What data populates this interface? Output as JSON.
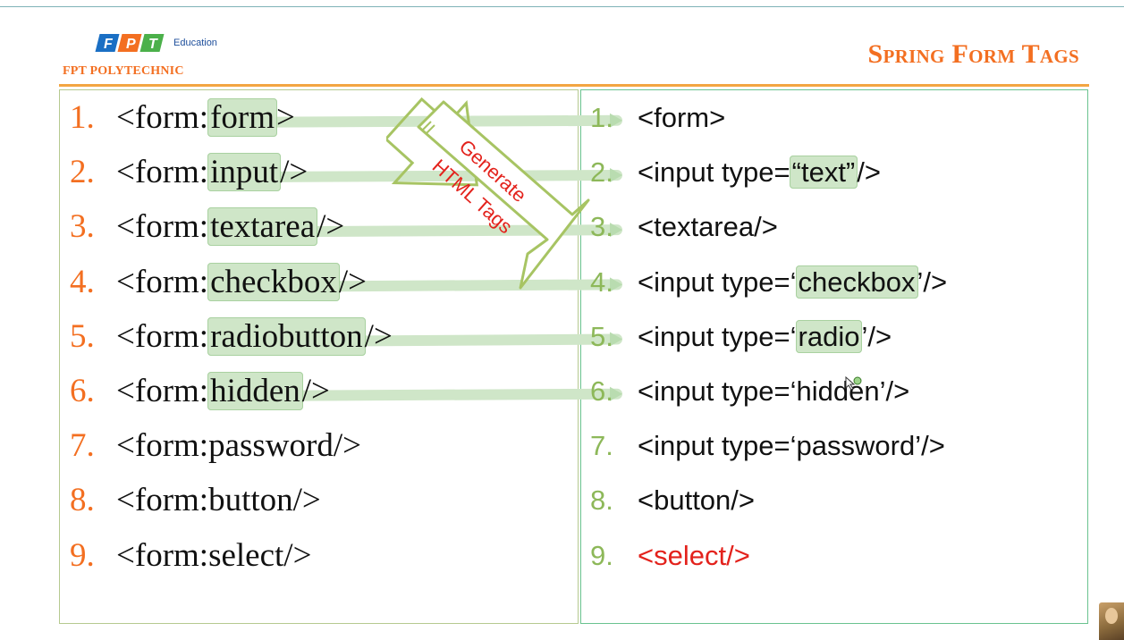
{
  "header": {
    "logo_edu": "Education",
    "logo_text": "FPT POLYTECHNIC",
    "title": "Spring Form Tags"
  },
  "colors": {
    "accent": "#f36f21",
    "highlight": "#cfe6c8",
    "green_number": "#8db859",
    "red": "#e3221c"
  },
  "callout": {
    "line1": "Generate",
    "line2": "HTML Tags"
  },
  "left_items": [
    {
      "num": "1.",
      "pre": "<form:",
      "hl": "form",
      "post": ">"
    },
    {
      "num": "2.",
      "pre": "<form:",
      "hl": "input",
      "post": "/>"
    },
    {
      "num": "3.",
      "pre": "<form:",
      "hl": "textarea",
      "post": "/>"
    },
    {
      "num": "4.",
      "pre": "<form:",
      "hl": "checkbox",
      "post": "/>"
    },
    {
      "num": "5.",
      "pre": "<form:",
      "hl": "radiobutton",
      "post": "/>"
    },
    {
      "num": "6.",
      "pre": "<form:",
      "hl": "hidden",
      "post": "/>"
    },
    {
      "num": "7.",
      "pre": "<form:password/>",
      "hl": "",
      "post": ""
    },
    {
      "num": "8.",
      "pre": "<form:button/>",
      "hl": "",
      "post": ""
    },
    {
      "num": "9.",
      "pre": "<form:select/>",
      "hl": "",
      "post": ""
    }
  ],
  "right_items": [
    {
      "num": "1.",
      "pre": "<form>",
      "hl": "",
      "post": ""
    },
    {
      "num": "2.",
      "pre": "<input type=",
      "hl": "“text”",
      "post": "/>"
    },
    {
      "num": "3.",
      "pre": "<textarea/>",
      "hl": "",
      "post": ""
    },
    {
      "num": "4.",
      "pre": "<input type=‘",
      "hl": "checkbox",
      "post": "’/>"
    },
    {
      "num": "5.",
      "pre": "<input type=‘",
      "hl": "radio",
      "post": "’/>"
    },
    {
      "num": "6.",
      "pre": "<input type=‘hidden’/>",
      "hl": "",
      "post": ""
    },
    {
      "num": "7.",
      "pre": "<input type=‘password’/>",
      "hl": "",
      "post": ""
    },
    {
      "num": "8.",
      "pre": "<button/>",
      "hl": "",
      "post": ""
    },
    {
      "num": "9.",
      "pre": "<select/>",
      "hl": "",
      "post": ""
    }
  ]
}
